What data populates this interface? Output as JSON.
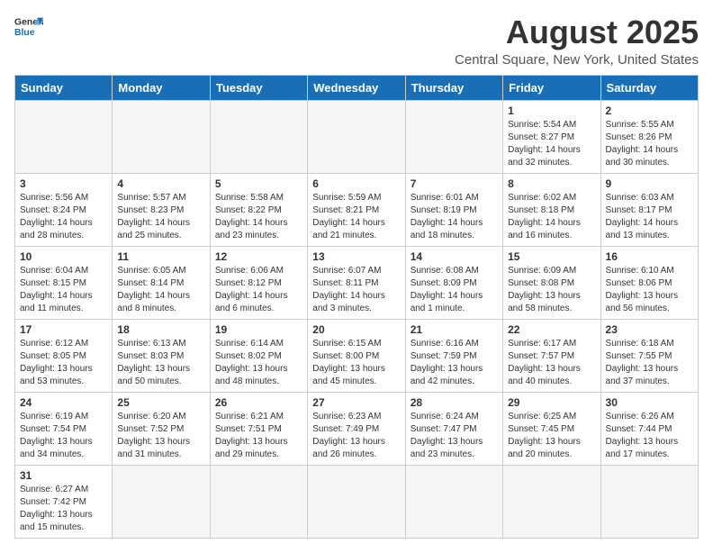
{
  "header": {
    "logo_general": "General",
    "logo_blue": "Blue",
    "title": "August 2025",
    "subtitle": "Central Square, New York, United States"
  },
  "weekdays": [
    "Sunday",
    "Monday",
    "Tuesday",
    "Wednesday",
    "Thursday",
    "Friday",
    "Saturday"
  ],
  "weeks": [
    [
      {
        "day": "",
        "info": "",
        "empty": true
      },
      {
        "day": "",
        "info": "",
        "empty": true
      },
      {
        "day": "",
        "info": "",
        "empty": true
      },
      {
        "day": "",
        "info": "",
        "empty": true
      },
      {
        "day": "",
        "info": "",
        "empty": true
      },
      {
        "day": "1",
        "info": "Sunrise: 5:54 AM\nSunset: 8:27 PM\nDaylight: 14 hours\nand 32 minutes."
      },
      {
        "day": "2",
        "info": "Sunrise: 5:55 AM\nSunset: 8:26 PM\nDaylight: 14 hours\nand 30 minutes."
      }
    ],
    [
      {
        "day": "3",
        "info": "Sunrise: 5:56 AM\nSunset: 8:24 PM\nDaylight: 14 hours\nand 28 minutes."
      },
      {
        "day": "4",
        "info": "Sunrise: 5:57 AM\nSunset: 8:23 PM\nDaylight: 14 hours\nand 25 minutes."
      },
      {
        "day": "5",
        "info": "Sunrise: 5:58 AM\nSunset: 8:22 PM\nDaylight: 14 hours\nand 23 minutes."
      },
      {
        "day": "6",
        "info": "Sunrise: 5:59 AM\nSunset: 8:21 PM\nDaylight: 14 hours\nand 21 minutes."
      },
      {
        "day": "7",
        "info": "Sunrise: 6:01 AM\nSunset: 8:19 PM\nDaylight: 14 hours\nand 18 minutes."
      },
      {
        "day": "8",
        "info": "Sunrise: 6:02 AM\nSunset: 8:18 PM\nDaylight: 14 hours\nand 16 minutes."
      },
      {
        "day": "9",
        "info": "Sunrise: 6:03 AM\nSunset: 8:17 PM\nDaylight: 14 hours\nand 13 minutes."
      }
    ],
    [
      {
        "day": "10",
        "info": "Sunrise: 6:04 AM\nSunset: 8:15 PM\nDaylight: 14 hours\nand 11 minutes."
      },
      {
        "day": "11",
        "info": "Sunrise: 6:05 AM\nSunset: 8:14 PM\nDaylight: 14 hours\nand 8 minutes."
      },
      {
        "day": "12",
        "info": "Sunrise: 6:06 AM\nSunset: 8:12 PM\nDaylight: 14 hours\nand 6 minutes."
      },
      {
        "day": "13",
        "info": "Sunrise: 6:07 AM\nSunset: 8:11 PM\nDaylight: 14 hours\nand 3 minutes."
      },
      {
        "day": "14",
        "info": "Sunrise: 6:08 AM\nSunset: 8:09 PM\nDaylight: 14 hours\nand 1 minute."
      },
      {
        "day": "15",
        "info": "Sunrise: 6:09 AM\nSunset: 8:08 PM\nDaylight: 13 hours\nand 58 minutes."
      },
      {
        "day": "16",
        "info": "Sunrise: 6:10 AM\nSunset: 8:06 PM\nDaylight: 13 hours\nand 56 minutes."
      }
    ],
    [
      {
        "day": "17",
        "info": "Sunrise: 6:12 AM\nSunset: 8:05 PM\nDaylight: 13 hours\nand 53 minutes."
      },
      {
        "day": "18",
        "info": "Sunrise: 6:13 AM\nSunset: 8:03 PM\nDaylight: 13 hours\nand 50 minutes."
      },
      {
        "day": "19",
        "info": "Sunrise: 6:14 AM\nSunset: 8:02 PM\nDaylight: 13 hours\nand 48 minutes."
      },
      {
        "day": "20",
        "info": "Sunrise: 6:15 AM\nSunset: 8:00 PM\nDaylight: 13 hours\nand 45 minutes."
      },
      {
        "day": "21",
        "info": "Sunrise: 6:16 AM\nSunset: 7:59 PM\nDaylight: 13 hours\nand 42 minutes."
      },
      {
        "day": "22",
        "info": "Sunrise: 6:17 AM\nSunset: 7:57 PM\nDaylight: 13 hours\nand 40 minutes."
      },
      {
        "day": "23",
        "info": "Sunrise: 6:18 AM\nSunset: 7:55 PM\nDaylight: 13 hours\nand 37 minutes."
      }
    ],
    [
      {
        "day": "24",
        "info": "Sunrise: 6:19 AM\nSunset: 7:54 PM\nDaylight: 13 hours\nand 34 minutes."
      },
      {
        "day": "25",
        "info": "Sunrise: 6:20 AM\nSunset: 7:52 PM\nDaylight: 13 hours\nand 31 minutes."
      },
      {
        "day": "26",
        "info": "Sunrise: 6:21 AM\nSunset: 7:51 PM\nDaylight: 13 hours\nand 29 minutes."
      },
      {
        "day": "27",
        "info": "Sunrise: 6:23 AM\nSunset: 7:49 PM\nDaylight: 13 hours\nand 26 minutes."
      },
      {
        "day": "28",
        "info": "Sunrise: 6:24 AM\nSunset: 7:47 PM\nDaylight: 13 hours\nand 23 minutes."
      },
      {
        "day": "29",
        "info": "Sunrise: 6:25 AM\nSunset: 7:45 PM\nDaylight: 13 hours\nand 20 minutes."
      },
      {
        "day": "30",
        "info": "Sunrise: 6:26 AM\nSunset: 7:44 PM\nDaylight: 13 hours\nand 17 minutes."
      }
    ],
    [
      {
        "day": "31",
        "info": "Sunrise: 6:27 AM\nSunset: 7:42 PM\nDaylight: 13 hours\nand 15 minutes.",
        "last": true
      },
      {
        "day": "",
        "info": "",
        "empty": true,
        "last": true
      },
      {
        "day": "",
        "info": "",
        "empty": true,
        "last": true
      },
      {
        "day": "",
        "info": "",
        "empty": true,
        "last": true
      },
      {
        "day": "",
        "info": "",
        "empty": true,
        "last": true
      },
      {
        "day": "",
        "info": "",
        "empty": true,
        "last": true
      },
      {
        "day": "",
        "info": "",
        "empty": true,
        "last": true
      }
    ]
  ]
}
